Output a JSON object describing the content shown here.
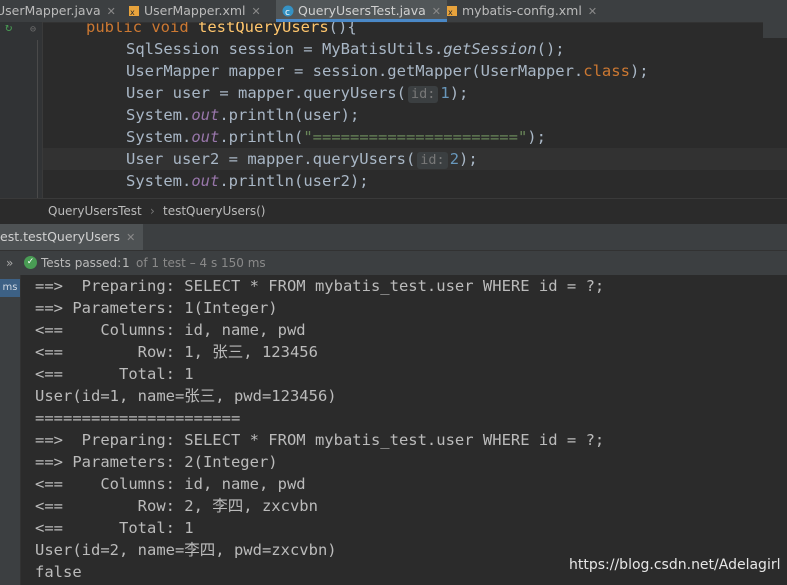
{
  "tabs": [
    {
      "label": "UserMapper.java",
      "active": false,
      "icon": "java-interface-icon"
    },
    {
      "label": "UserMapper.xml",
      "active": false,
      "icon": "xml-file-icon"
    },
    {
      "label": "QueryUsersTest.java",
      "active": true,
      "icon": "java-class-icon"
    },
    {
      "label": "mybatis-config.xml",
      "active": false,
      "icon": "xml-file-icon"
    }
  ],
  "editor": {
    "hints": {
      "id1": "id:",
      "id2": "id:"
    },
    "lines": {
      "l0_kw1": "public",
      "l0_kw2": "void",
      "l0_fn": "testQueryUsers",
      "l0_tail": "(){",
      "l1_a": "SqlSession session = MyBatisUtils.",
      "l1_b": "getSession",
      "l1_c": "();",
      "l2_a": "UserMapper mapper = session.getMapper(UserMapper.",
      "l2_b": "class",
      "l2_c": ");",
      "l3_a": "User user = mapper.queryUsers(",
      "l3_num": "1",
      "l3_c": ");",
      "l4_a": "System.",
      "l4_b": "out",
      "l4_c": ".println(user);",
      "l5_a": "System.",
      "l5_b": "out",
      "l5_c": ".println(",
      "l5_str": "\"======================\"",
      "l5_d": ");",
      "l6_a": "User user2 = mapper.queryUsers(",
      "l6_num": "2",
      "l6_c": ");",
      "l7_a": "System.",
      "l7_b": "out",
      "l7_c": ".println(user2);"
    }
  },
  "breadcrumbs": [
    "QueryUsersTest",
    "›",
    "testQueryUsers()"
  ],
  "run": {
    "tab_label": "est.testQueryUsers",
    "status_label": "Tests passed:",
    "status_count": "1",
    "status_detail": "of 1 test – 4 s 150 ms",
    "side_label": "ms"
  },
  "console": [
    "==>  Preparing: SELECT * FROM mybatis_test.user WHERE id = ?;",
    "==> Parameters: 1(Integer)",
    "<==    Columns: id, name, pwd",
    "<==        Row: 1, 张三, 123456",
    "<==      Total: 1",
    "User(id=1, name=张三, pwd=123456)",
    "======================",
    "==>  Preparing: SELECT * FROM mybatis_test.user WHERE id = ?;",
    "==> Parameters: 2(Integer)",
    "<==    Columns: id, name, pwd",
    "<==        Row: 2, 李四, zxcvbn",
    "<==      Total: 1",
    "User(id=2, name=李四, pwd=zxcvbn)",
    "false"
  ],
  "watermark": "https://blog.csdn.net/Adelagirl"
}
